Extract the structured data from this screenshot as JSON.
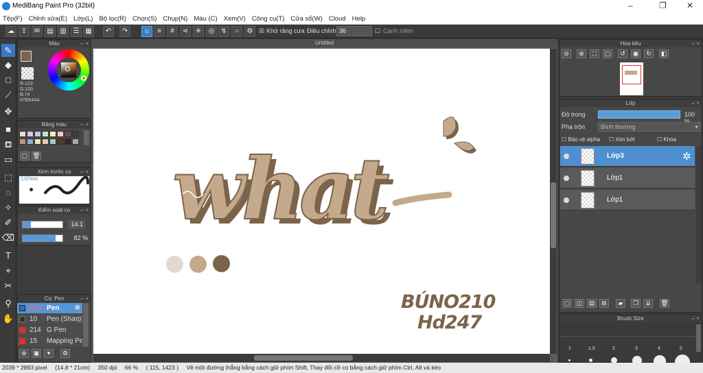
{
  "app": {
    "title": "MediBang Paint Pro (32bit)",
    "minimize": "–",
    "maximize": "❐",
    "close": "✕"
  },
  "menu": [
    "Tệp(F)",
    "Chỉnh sửa(E)",
    "Lớp(L)",
    "Bộ lọc(R)",
    "Chọn(S)",
    "Chụp(N)",
    "Màu (C)",
    "Xem(V)",
    "Công cụ(T)",
    "Cửa sổ(W)",
    "Cloud",
    "Help"
  ],
  "toolbar": {
    "antialias_label": "Khử răng cưa",
    "adjust_label": "Điều chỉnh",
    "adjust_value": "36",
    "smooth_label": "Cạnh mềm"
  },
  "color_panel": {
    "title": "Màu",
    "r": "R:123",
    "g": "G:100",
    "b": "B:74",
    "hex": "#7B644A",
    "primary_color": "#7B644A"
  },
  "palette_panel": {
    "title": "Bảng màu",
    "colors": [
      "#f2d7d2",
      "#d7c7e8",
      "#b9cce6",
      "#c8e3cd",
      "#f6f0b5",
      "#f0c6c6",
      "#6d4c5a",
      "#3d3d3d",
      "#c98c86",
      "#8cb0d1",
      "#e5e8a8",
      "#e5c9a9",
      "#9bcfb7",
      "#4f3c2d",
      "#2b2b2b",
      "#aaaaaa"
    ]
  },
  "brush_preview": {
    "title": "Xem trước cọ",
    "size": "1.07mm"
  },
  "brush_control": {
    "title": "Kiểm soát cọ",
    "size": "14.1",
    "opacity": "82 %",
    "size_fill": 0.2,
    "opacity_fill": 0.82
  },
  "brush_panel": {
    "title": "Cọ: Pen",
    "items": [
      {
        "size": "14.1",
        "name": "Pen",
        "color": "#3a6cb0",
        "selected": true
      },
      {
        "size": "10",
        "name": "Pen (Sharp)",
        "color": "#333333",
        "selected": false
      },
      {
        "size": "214",
        "name": "G Pen",
        "color": "#e03030",
        "selected": false
      },
      {
        "size": "15",
        "name": "Mapping Pen",
        "color": "#e03030",
        "selected": false
      }
    ]
  },
  "document": {
    "tab": "Untitled",
    "word": "what",
    "signature_line1": "BÚNO210",
    "signature_line2": "Hd247",
    "swatches": [
      "#e3d8cf",
      "#c4a98d",
      "#7b644a"
    ]
  },
  "navigator": {
    "title": "Hoa tiêu"
  },
  "layers": {
    "title": "Lớp",
    "opacity_label": "Độ trong",
    "opacity_value": "100 %",
    "blend_label": "Pha trộn",
    "blend_value": "Bình thường",
    "protect_alpha": "Bảo vệ alpha",
    "clip": "Xén bớt",
    "lock": "Khóa",
    "items": [
      {
        "name": "Lớp3",
        "selected": true
      },
      {
        "name": "Lớp1",
        "selected": false
      },
      {
        "name": "Lớp1",
        "selected": false
      }
    ]
  },
  "brush_size": {
    "title": "Brush Size",
    "labels": [
      "1",
      "1.5",
      "2",
      "3",
      "4",
      "5"
    ]
  },
  "status": {
    "pixels": "2039 * 2893 pixel",
    "cm": "(14.8 * 21cm)",
    "dpi": "350 dpi",
    "zoom": "66 %",
    "coords": "( 115, 1423 )",
    "hint": "Vẽ một đường thẳng bằng cách giữ phím Shift, Thay đổi cỡ cọ bằng cách giữ phím Ctrl, Alt và kéo"
  }
}
